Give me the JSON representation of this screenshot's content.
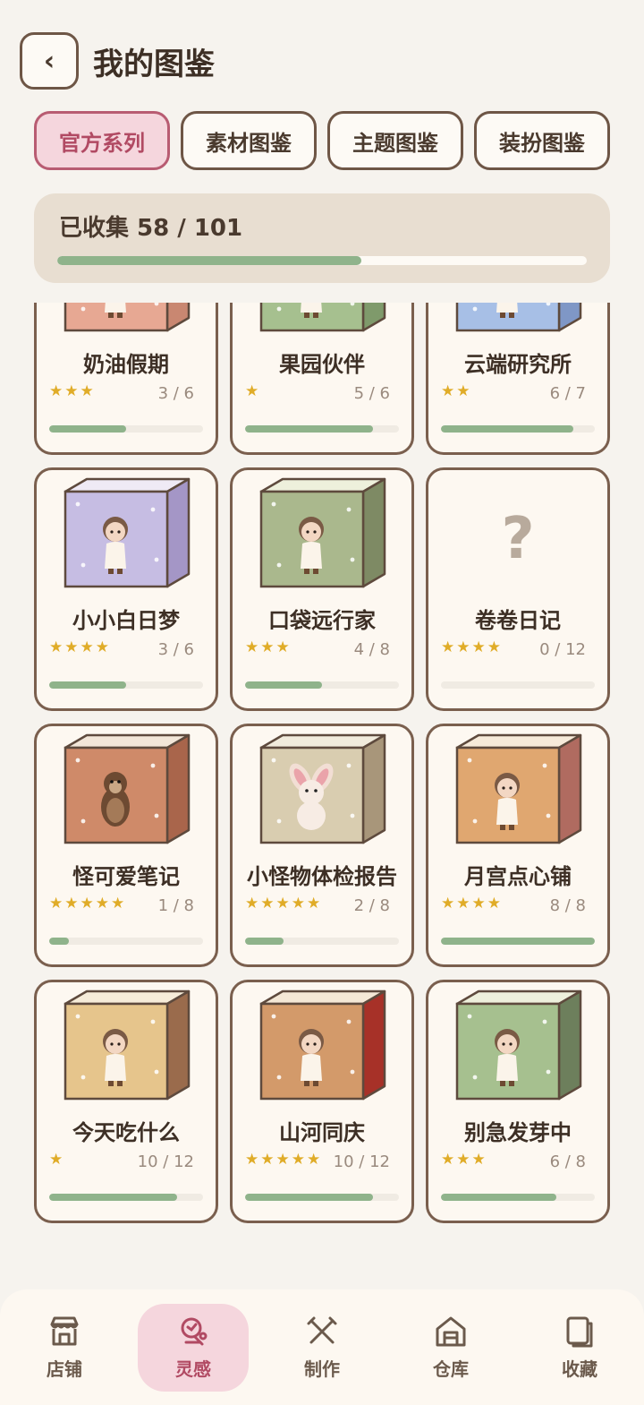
{
  "header": {
    "back_icon": "chevron-left-icon",
    "title": "我的图鉴"
  },
  "tabs": [
    {
      "label": "官方系列",
      "active": true
    },
    {
      "label": "素材图鉴",
      "active": false
    },
    {
      "label": "主题图鉴",
      "active": false
    },
    {
      "label": "装扮图鉴",
      "active": false
    }
  ],
  "progress": {
    "label": "已收集 58 / 101",
    "collected": 58,
    "total": 101
  },
  "series": [
    {
      "name": "奶油假期",
      "stars": "★★★",
      "count": "3 / 6",
      "progress": 0.5,
      "box_color": "#e7a893",
      "side_color": "#c98771",
      "top_color": "#f3efe4",
      "figure": "doll"
    },
    {
      "name": "果园伙伴",
      "stars": "★",
      "count": "5 / 6",
      "progress": 0.83,
      "box_color": "#a6c08f",
      "side_color": "#7f9a6b",
      "top_color": "#f3efe4",
      "figure": "doll"
    },
    {
      "name": "云端研究所",
      "stars": "★★",
      "count": "6 / 7",
      "progress": 0.86,
      "box_color": "#a7bfe6",
      "side_color": "#7f97c6",
      "top_color": "#f3efe4",
      "figure": "doll"
    },
    {
      "name": "小小白日梦",
      "stars": "★★★★",
      "count": "3 / 6",
      "progress": 0.5,
      "box_color": "#c6bde3",
      "side_color": "#a496c6",
      "top_color": "#efeaf5",
      "figure": "doll"
    },
    {
      "name": "口袋远行家",
      "stars": "★★★",
      "count": "4 / 8",
      "progress": 0.5,
      "box_color": "#aab88d",
      "side_color": "#7e8a64",
      "top_color": "#eef0dc",
      "figure": "doll"
    },
    {
      "name": "卷卷日记",
      "stars": "★★★★",
      "count": "0 / 12",
      "progress": 0,
      "box_color": "",
      "side_color": "",
      "top_color": "",
      "figure": "unknown",
      "placeholder": "?"
    },
    {
      "name": "怪可爱笔记",
      "stars": "★★★★★",
      "count": "1 / 8",
      "progress": 0.125,
      "box_color": "#cf8a69",
      "side_color": "#a9654b",
      "top_color": "#f2e6d8",
      "figure": "otter"
    },
    {
      "name": "小怪物体检报告",
      "stars": "★★★★★",
      "count": "2 / 8",
      "progress": 0.25,
      "box_color": "#d9cdb0",
      "side_color": "#a8967a",
      "top_color": "#f1ebdc",
      "figure": "bunny"
    },
    {
      "name": "月宫点心铺",
      "stars": "★★★★",
      "count": "8 / 8",
      "progress": 1,
      "box_color": "#e0a770",
      "side_color": "#b06b60",
      "top_color": "#f6ead9",
      "figure": "doll"
    },
    {
      "name": "今天吃什么",
      "stars": "★",
      "count": "10 / 12",
      "progress": 0.83,
      "box_color": "#e6c58c",
      "side_color": "#9a6b4c",
      "top_color": "#f6ecd9",
      "figure": "doll"
    },
    {
      "name": "山河同庆",
      "stars": "★★★★★",
      "count": "10 / 12",
      "progress": 0.83,
      "box_color": "#d39a6a",
      "side_color": "#a73128",
      "top_color": "#f4e8d6",
      "figure": "doll"
    },
    {
      "name": "别急发芽中",
      "stars": "★★★",
      "count": "6 / 8",
      "progress": 0.75,
      "box_color": "#a6c08f",
      "side_color": "#6d7f5c",
      "top_color": "#eef0dc",
      "figure": "doll"
    }
  ],
  "bottom_nav": [
    {
      "label": "店铺",
      "icon": "store-icon",
      "active": false
    },
    {
      "label": "灵感",
      "icon": "inspiration-icon",
      "active": true
    },
    {
      "label": "制作",
      "icon": "craft-tools-icon",
      "active": false
    },
    {
      "label": "仓库",
      "icon": "warehouse-icon",
      "active": false
    },
    {
      "label": "收藏",
      "icon": "collection-icon",
      "active": false
    }
  ]
}
